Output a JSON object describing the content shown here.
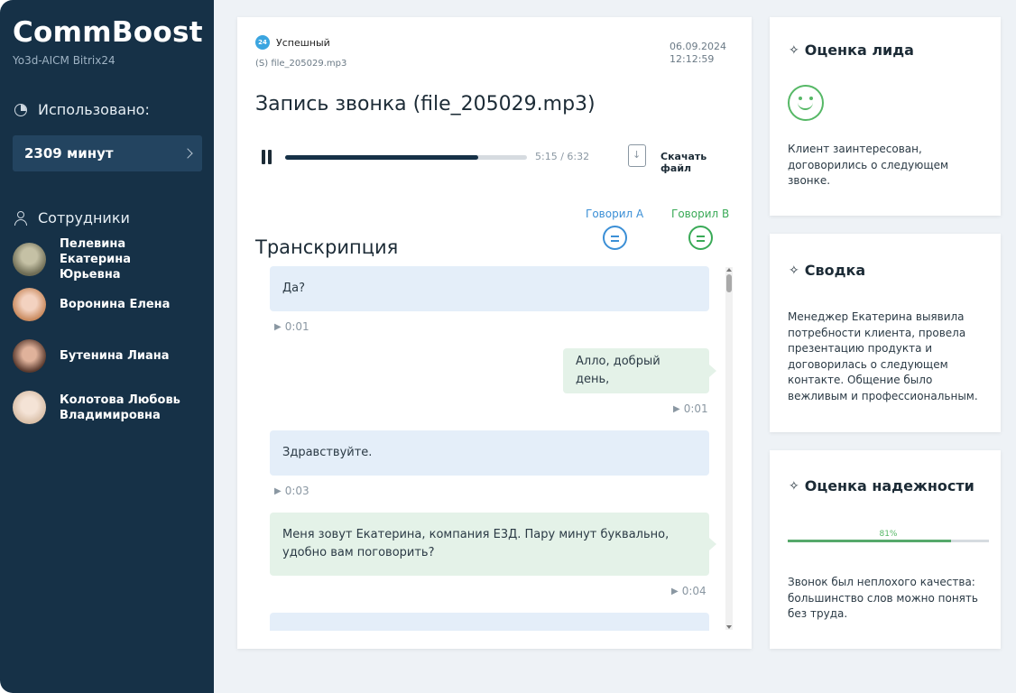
{
  "sidebar": {
    "brand": "CommBoost",
    "subtitle": "Yo3d-AICM Bitrix24",
    "used_label": "Использовано:",
    "minutes": "2309 минут",
    "staff_label": "Сотрудники",
    "employees": [
      {
        "name": "Пелевина Екатерина Юрьевна",
        "avatar_color": "#8c8a6f"
      },
      {
        "name": "Воронина Елена",
        "avatar_color": "#d9a08a"
      },
      {
        "name": "Бутенина Лиана",
        "avatar_color": "#a7705c"
      },
      {
        "name": "Колотова Любовь Владимировна",
        "avatar_color": "#e3ccb8"
      }
    ]
  },
  "call": {
    "status_icon": "24",
    "status": "Успешный",
    "file_tag": "(S) file_205029.mp3",
    "date": "06.09.2024",
    "time": "12:12:59",
    "title": "Запись звонка (file_205029.mp3)",
    "playback_time": "5:15 / 6:32",
    "progress": 0.8,
    "download_label": "Скачать файл"
  },
  "transcript": {
    "title": "Транскрипция",
    "speaker_a": "Говорил A",
    "speaker_b": "Говорил B",
    "speaker_a_color": "#3b8fd6",
    "speaker_b_color": "#3aaa57",
    "messages": [
      {
        "speaker": "A",
        "text": "Да?",
        "time": "0:01"
      },
      {
        "speaker": "B",
        "text": "Алло, добрый день,",
        "time": "0:01"
      },
      {
        "speaker": "A",
        "text": "Здравствуйте.",
        "time": "0:03"
      },
      {
        "speaker": "B",
        "text": "Меня зовут Екатерина, компания Е3Д. Пару минут буквально, удобно вам поговорить?",
        "time": "0:04"
      }
    ]
  },
  "lead": {
    "title": "Оценка лида",
    "icon": "smiley-icon",
    "text": "Клиент заинтересован, договорились о следующем звонке."
  },
  "summary": {
    "title": "Сводка",
    "text": "Менеджер Екатерина выявила потребности клиента, провела презентацию продукта и договорилась о следующем контакте. Общение было вежливым и профессиональным."
  },
  "reliability": {
    "title": "Оценка надежности",
    "percent_label": "81%",
    "percent": 0.81,
    "text": "Звонок был неплохого качества: большинство слов можно понять без труда."
  }
}
